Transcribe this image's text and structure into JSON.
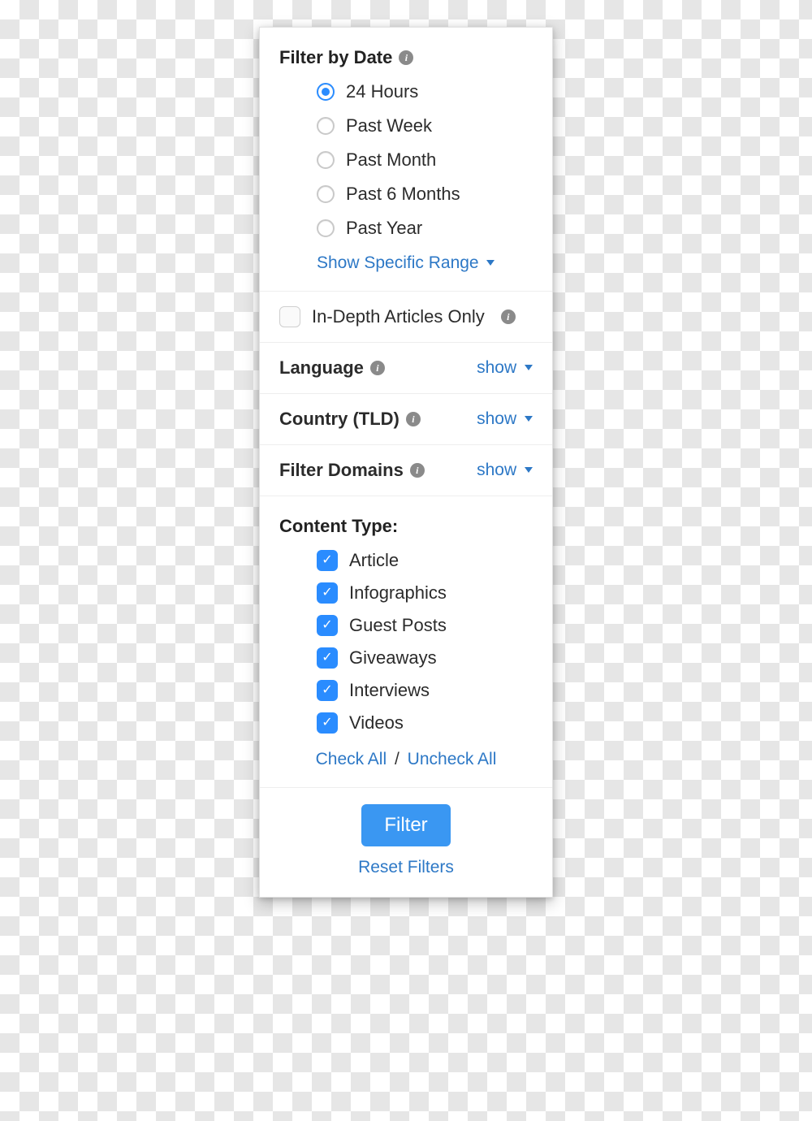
{
  "date": {
    "title": "Filter by Date",
    "options": [
      "24 Hours",
      "Past Week",
      "Past Month",
      "Past 6 Months",
      "Past Year"
    ],
    "selected": 0,
    "show_range": "Show Specific Range"
  },
  "indepth": {
    "label": "In-Depth Articles Only",
    "checked": false
  },
  "language": {
    "title": "Language",
    "toggle": "show"
  },
  "country": {
    "title": "Country (TLD)",
    "toggle": "show"
  },
  "domains": {
    "title": "Filter Domains",
    "toggle": "show"
  },
  "content": {
    "title": "Content Type:",
    "options": [
      {
        "label": "Article",
        "checked": true
      },
      {
        "label": "Infographics",
        "checked": true
      },
      {
        "label": "Guest Posts",
        "checked": true
      },
      {
        "label": "Giveaways",
        "checked": true
      },
      {
        "label": "Interviews",
        "checked": true
      },
      {
        "label": "Videos",
        "checked": true
      }
    ],
    "check_all": "Check All",
    "uncheck_all": "Uncheck All",
    "sep": "/"
  },
  "footer": {
    "filter": "Filter",
    "reset": "Reset Filters"
  }
}
